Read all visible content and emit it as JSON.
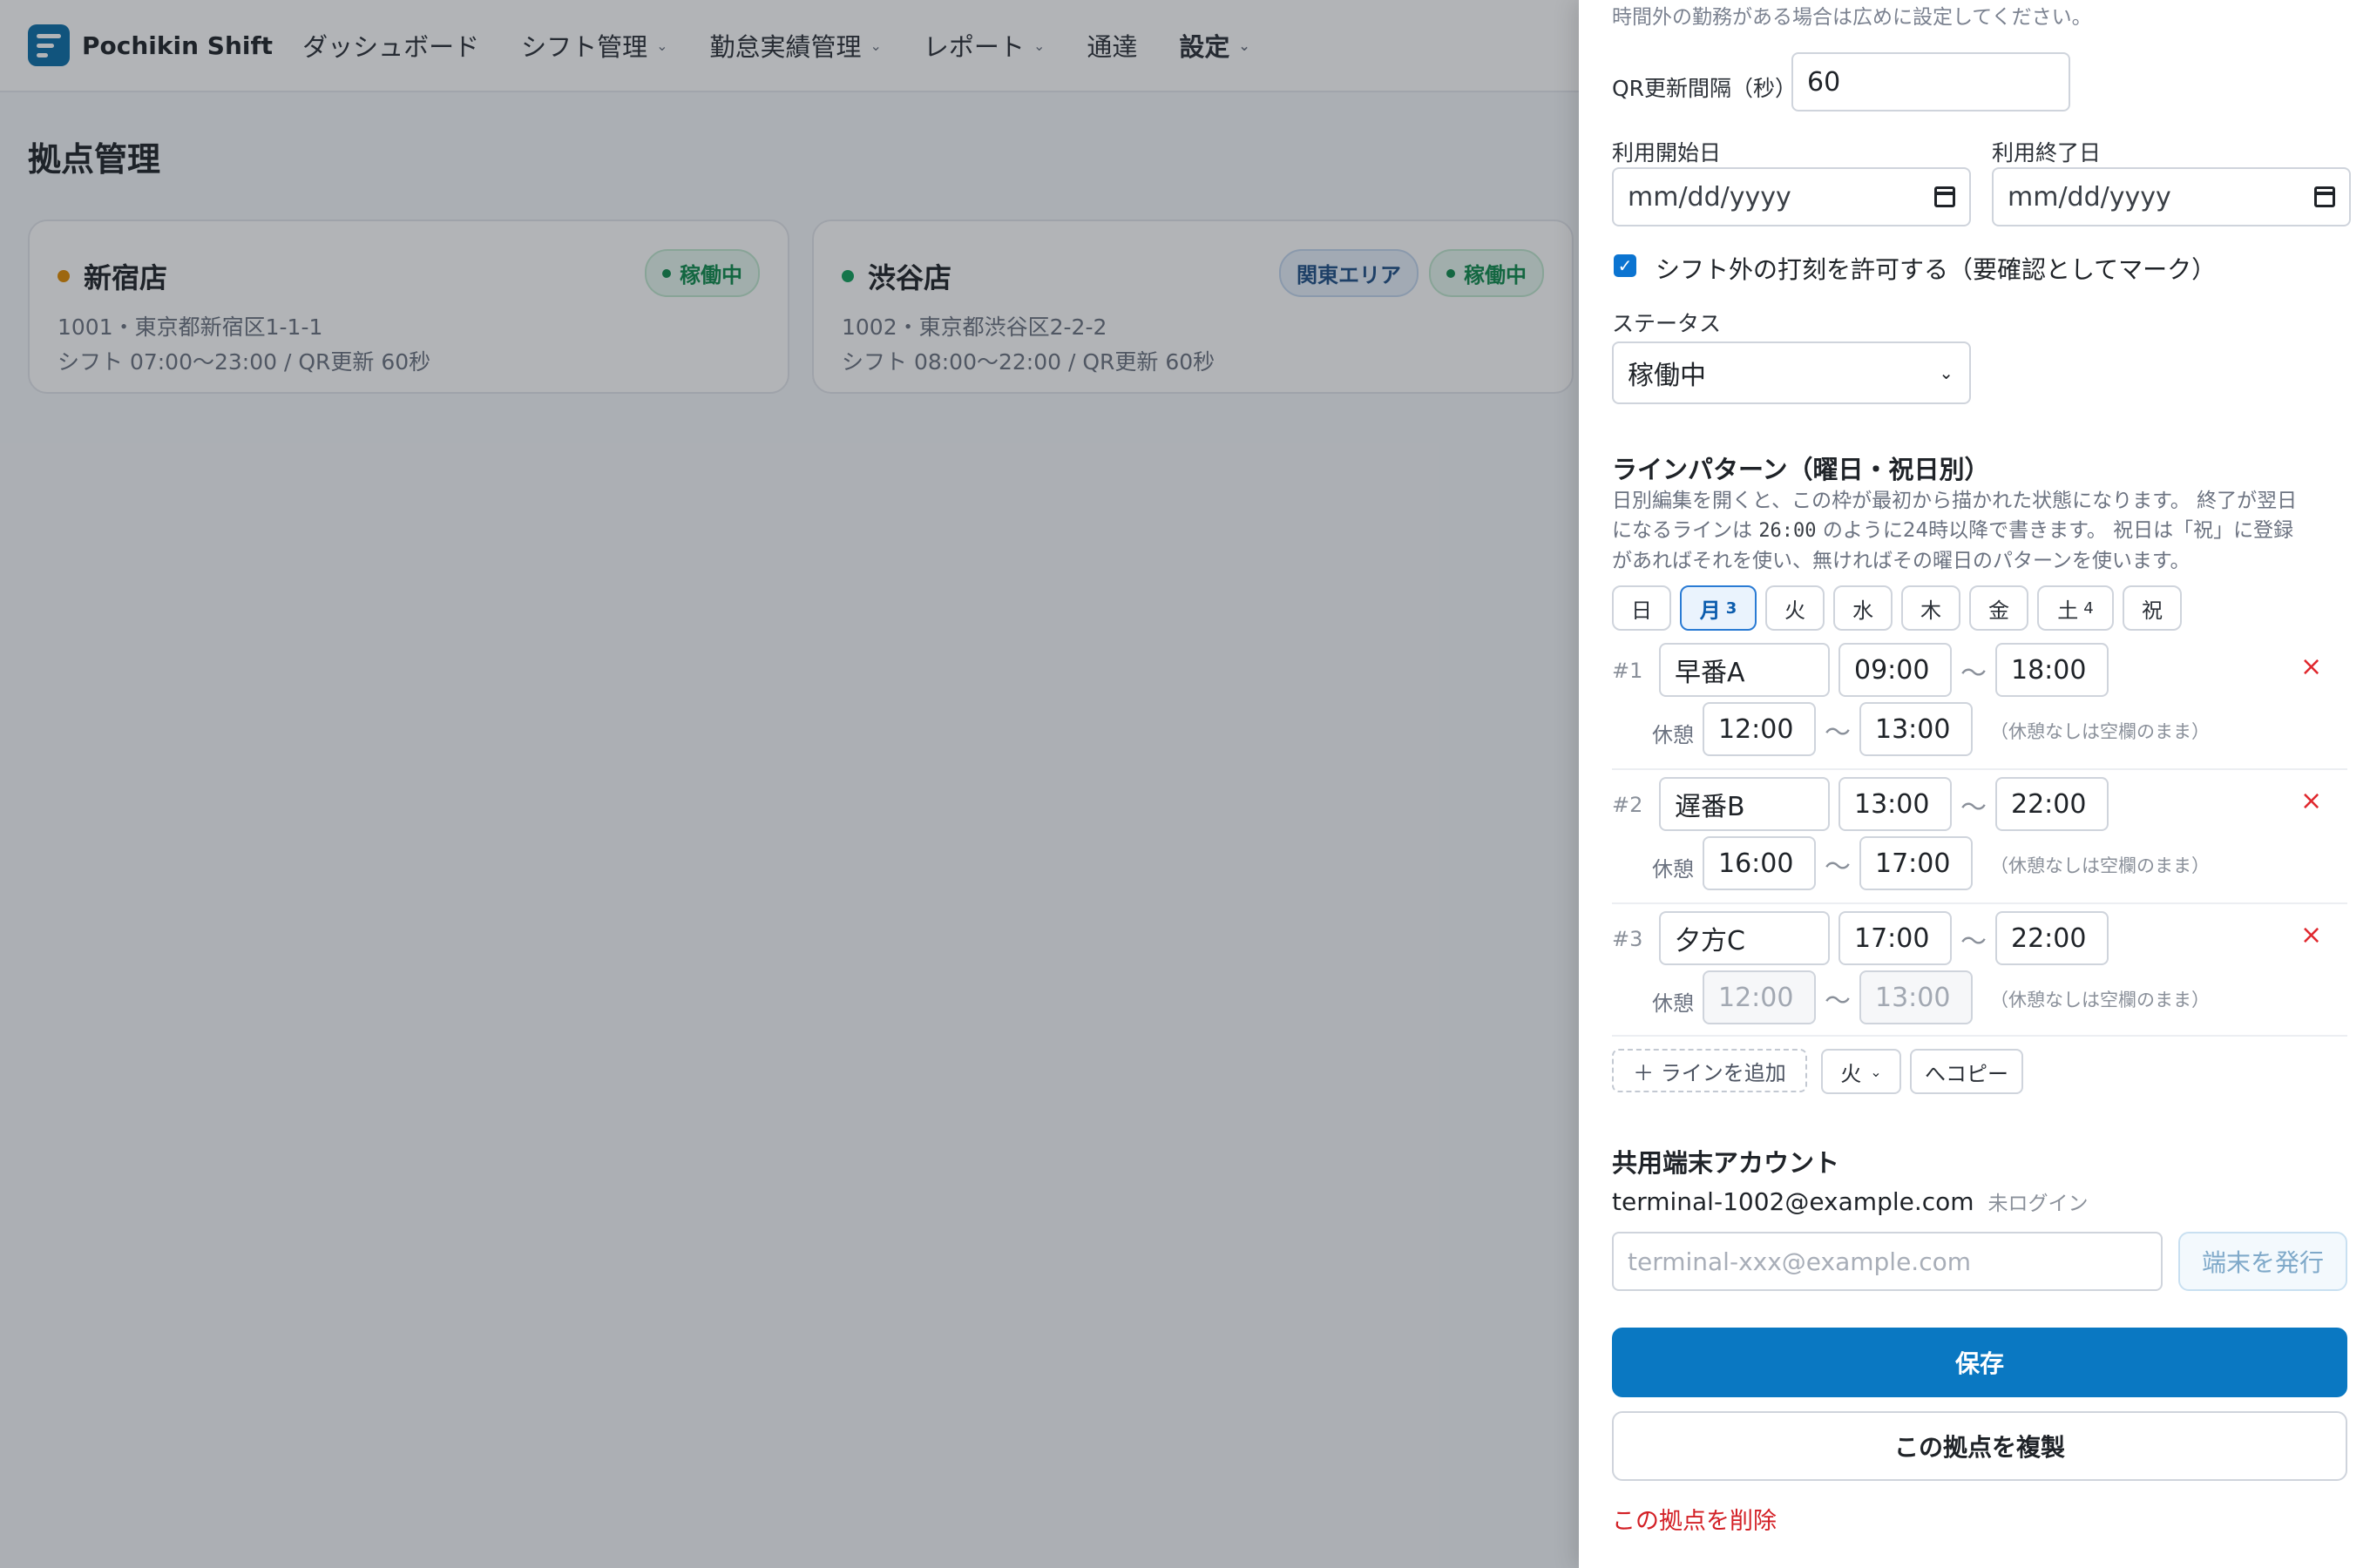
{
  "app": {
    "brand": "Pochikin Shift",
    "nav": [
      {
        "label": "ダッシュボード"
      },
      {
        "label": "シフト管理"
      },
      {
        "label": "勤怠実績管理"
      },
      {
        "label": "レポート"
      },
      {
        "label": "通達"
      },
      {
        "label": "設定"
      }
    ],
    "page_title": "拠点管理"
  },
  "locations": [
    {
      "name": "新宿店",
      "dot_color": "#e08a00",
      "badges": [
        "稼働中"
      ],
      "meta_line1": "1001・東京都新宿区1-1-1",
      "meta_line2": "シフト 07:00〜23:00 / QR更新 60秒"
    },
    {
      "name": "渋谷店",
      "dot_color": "#12a05c",
      "badges": [
        "関東エリア",
        "稼働中"
      ],
      "meta_line1": "1002・東京都渋谷区2-2-2",
      "meta_line2": "シフト 08:00〜22:00 / QR更新 60秒"
    }
  ],
  "drawer": {
    "top_hint": "時間外の勤務がある場合は広めに設定してください。",
    "qr_label": "QR更新間隔（秒）",
    "qr_value": "60",
    "start_label": "利用開始日",
    "start_placeholder": "mm/dd/yyyy",
    "end_label": "利用終了日",
    "end_placeholder": "mm/dd/yyyy",
    "allow_label": "シフト外の打刻を許可する（要確認としてマーク）",
    "status_label": "ステータス",
    "status_value": "稼働中",
    "line_title": "ラインパターン（曜日・祝日別）",
    "desc_1": "日別編集を開くと、この枠が最初から描かれた状態になります。 終了が翌日",
    "desc_2a": "になるラインは ",
    "desc_2b": "26:00",
    "desc_2c": " のように24時以降で書きます。 祝日は「祝」に登録",
    "desc_3": "があればそれを使い、無ければその曜日のパターンを使います。",
    "days": [
      {
        "label": "日",
        "count": ""
      },
      {
        "label": "月",
        "count": "3"
      },
      {
        "label": "火",
        "count": ""
      },
      {
        "label": "水",
        "count": ""
      },
      {
        "label": "木",
        "count": ""
      },
      {
        "label": "金",
        "count": ""
      },
      {
        "label": "土",
        "count": "4"
      },
      {
        "label": "祝",
        "count": ""
      }
    ],
    "lines": [
      {
        "num": "#1",
        "name": "早番A",
        "start": "09:00",
        "end": "18:00",
        "break_start": "12:00",
        "break_end": "13:00"
      },
      {
        "num": "#2",
        "name": "遅番B",
        "start": "13:00",
        "end": "22:00",
        "break_start": "16:00",
        "break_end": "17:00"
      },
      {
        "num": "#3",
        "name": "夕方C",
        "start": "17:00",
        "end": "22:00",
        "break_start": "12:00",
        "break_end": "13:00"
      }
    ],
    "tilde": "〜",
    "break_label": "休憩",
    "break_hint": "（休憩なしは空欄のまま）",
    "remove_glyph": "×",
    "add_line": "＋ ラインを追加",
    "copy_target": "火",
    "copy_button": "へコピー",
    "terminal_title": "共用端末アカウント",
    "terminal_email": "terminal-1002@example.com",
    "terminal_status": "未ログイン",
    "terminal_placeholder": "terminal-xxx@example.com",
    "issue_button": "端末を発行",
    "save_button": "保存",
    "duplicate_button": "この拠点を複製",
    "delete_link": "この拠点を削除"
  }
}
